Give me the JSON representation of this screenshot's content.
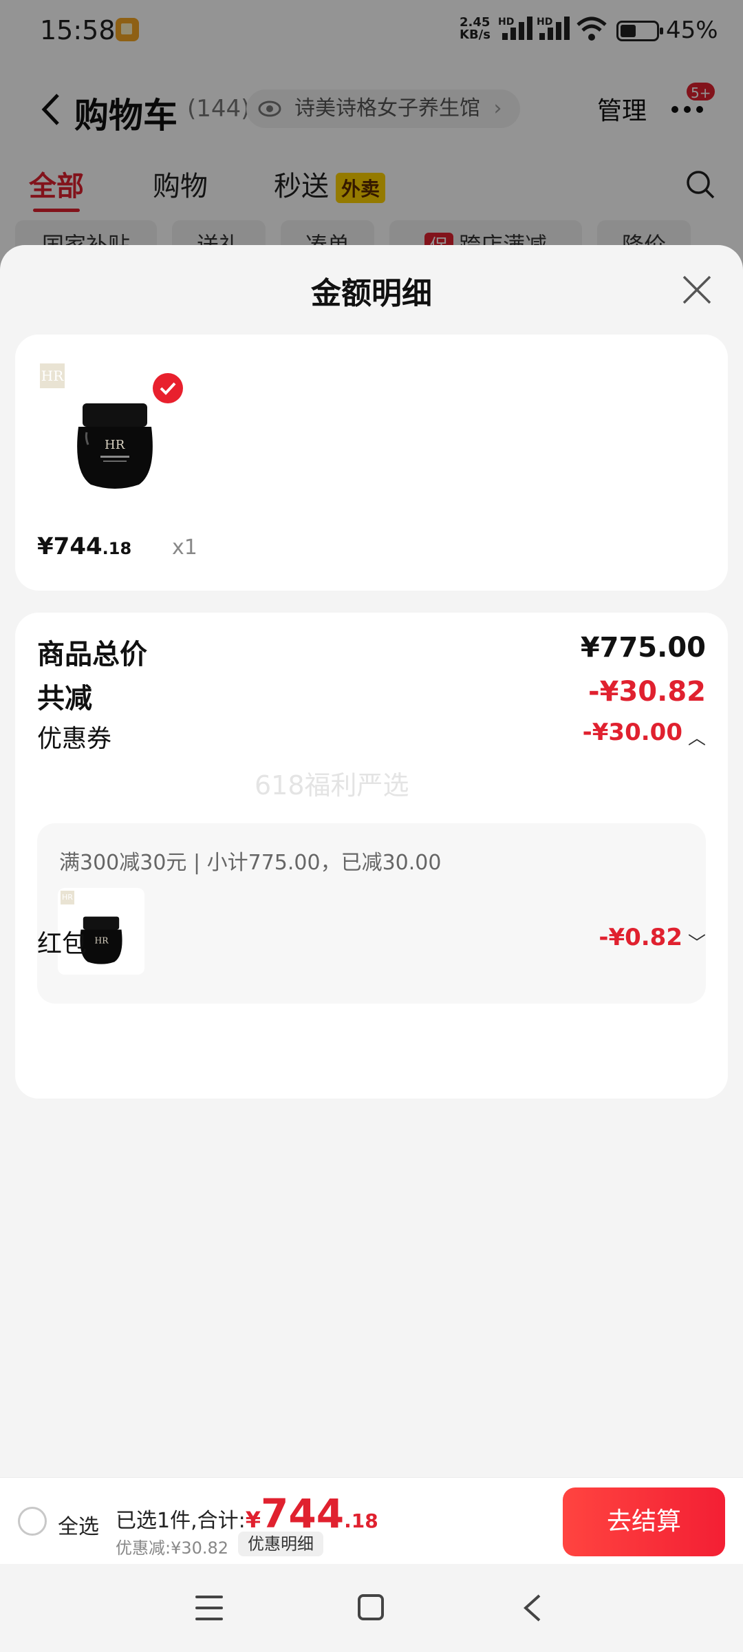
{
  "status_bar": {
    "time": "15:58",
    "net_speed_value": "2.45",
    "net_speed_unit": "KB/s",
    "hd1": "HD",
    "hd2": "HD",
    "battery": "45%"
  },
  "header": {
    "title": "购物车",
    "count": "(144)",
    "store_chip": "诗美诗格女子养生馆",
    "manage": "管理",
    "badge": "5+"
  },
  "tabs": [
    {
      "label": "全部",
      "active": true
    },
    {
      "label": "购物",
      "active": false
    },
    {
      "label": "秒送",
      "active": false,
      "tag": "外卖"
    }
  ],
  "filters": [
    "国家补贴",
    "送礼",
    "凑单",
    "跨店满减",
    "降价"
  ],
  "filter_tag": "促",
  "sheet": {
    "title": "金额明细",
    "product": {
      "brand": "HR",
      "price_int": "¥744",
      "price_dec": ".18",
      "qty": "x1"
    },
    "summary": {
      "total_label": "商品总价",
      "total_value": "¥775.00",
      "reduce_label": "共减",
      "reduce_value": "-¥30.82",
      "coupon_label": "优惠券",
      "coupon_value": "-¥30.00",
      "watermark": "618福利严选",
      "coupon_detail": "满300减30元 | 小计775.00，已减30.00",
      "redpacket_label": "红包",
      "redpacket_value": "-¥0.82"
    }
  },
  "bottom_bar": {
    "select_all": "全选",
    "selected_prefix": "已选1件,合计:",
    "total_yen": "¥",
    "total_int": "744",
    "total_dec": ".18",
    "discount": "优惠减:¥30.82",
    "detail_button": "优惠明细",
    "checkout_button": "去结算"
  },
  "colors": {
    "accent_red": "#e0212f",
    "checkout_gradient": [
      "#ff4440",
      "#f31f34"
    ],
    "waimai_tag": "#ffd200"
  }
}
